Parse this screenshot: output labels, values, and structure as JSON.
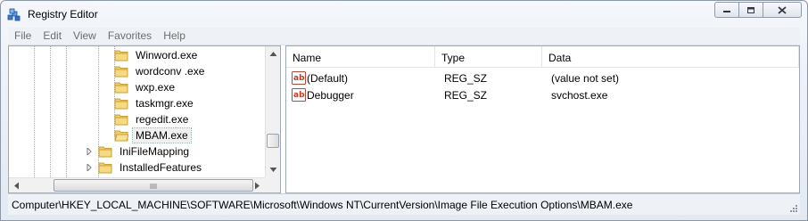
{
  "window": {
    "title": "Registry Editor"
  },
  "icons": {
    "app": "registry-editor-icon",
    "minimize": "minimize-icon",
    "maximize": "maximize-icon",
    "close": "close-icon",
    "folder": "folder-icon",
    "string_value": "reg-sz-icon"
  },
  "menu": [
    "File",
    "Edit",
    "View",
    "Favorites",
    "Help"
  ],
  "tree": {
    "items": [
      {
        "label": "Winword.exe",
        "selected": false
      },
      {
        "label": "wordconv .exe",
        "selected": false
      },
      {
        "label": "wxp.exe",
        "selected": false
      },
      {
        "label": "taskmgr.exe",
        "selected": false
      },
      {
        "label": "regedit.exe",
        "selected": false
      },
      {
        "label": "MBAM.exe",
        "selected": true
      },
      {
        "label": "IniFileMapping",
        "selected": false
      },
      {
        "label": "InstalledFeatures",
        "selected": false
      }
    ]
  },
  "list": {
    "columns": [
      "Name",
      "Type",
      "Data"
    ],
    "rows": [
      {
        "name": "(Default)",
        "type": "REG_SZ",
        "data": "(value not set)"
      },
      {
        "name": "Debugger",
        "type": "REG_SZ",
        "data": "svchost.exe"
      }
    ]
  },
  "status": {
    "path": "Computer\\HKEY_LOCAL_MACHINE\\SOFTWARE\\Microsoft\\Windows NT\\CurrentVersion\\Image File Execution Options\\MBAM.exe"
  }
}
